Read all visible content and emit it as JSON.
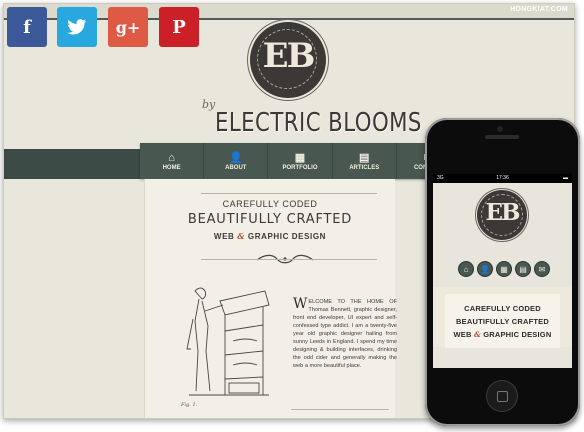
{
  "share_buttons": [
    {
      "name": "facebook",
      "glyph": "f"
    },
    {
      "name": "twitter",
      "glyph": "🐦"
    },
    {
      "name": "google-plus",
      "glyph": "g+"
    },
    {
      "name": "pinterest",
      "glyph": "P"
    }
  ],
  "site": {
    "brand": "HONGKIAT.COM",
    "monogram": "EB",
    "by": "by",
    "name": "ELECTRIC BLOOMS"
  },
  "nav": [
    {
      "label": "HOME",
      "icon": "home-icon",
      "glyph": "⌂"
    },
    {
      "label": "ABOUT",
      "icon": "person-icon",
      "glyph": "👤"
    },
    {
      "label": "PORTFOLIO",
      "icon": "calendar-icon",
      "glyph": "▦"
    },
    {
      "label": "ARTICLES",
      "icon": "document-icon",
      "glyph": "▤"
    },
    {
      "label": "CONTACT",
      "icon": "mail-icon",
      "glyph": "✉"
    }
  ],
  "hero": {
    "line1": "CAREFULLY CODED",
    "line2": "BEAUTIFULLY CRAFTED",
    "line3_a": "WEB",
    "line3_amp": "&",
    "line3_b": "GRAPHIC DESIGN"
  },
  "caption": "Fig. 1.",
  "intro": {
    "dropcap": "W",
    "text": "ELCOME TO THE HOME OF Thomas Bennett, graphic designer, front end developer, UI expert and self-confessed type addict. I am a twenty-five year old graphic designer hailing from sunny Leeds in England. I spend my time designing & building interfaces, drinking the odd cider and generally making the web a more beautiful place."
  },
  "phone": {
    "carrier": "3G",
    "time": "17:36",
    "battery": "▬",
    "monogram": "EB",
    "line1": "CAREFULLY CODED",
    "line2": "BEAUTIFULLY CRAFTED",
    "line3_a": "WEB",
    "line3_amp": "&",
    "line3_b": "GRAPHIC DESIGN",
    "nav_glyphs": [
      "⌂",
      "👤",
      "▦",
      "▤",
      "✉"
    ]
  },
  "colors": {
    "facebook": "#3b5998",
    "twitter": "#29a8e0",
    "google_plus": "#df5a45",
    "pinterest": "#cb2027",
    "nav": "#48574f",
    "accent": "#b04a3a"
  }
}
